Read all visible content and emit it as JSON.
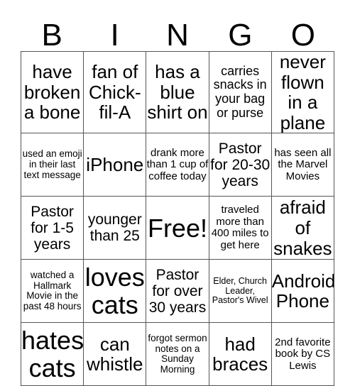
{
  "header": {
    "letters": [
      "B",
      "I",
      "N",
      "G",
      "O"
    ]
  },
  "cells": [
    [
      "have broken a bone",
      "fan of Chick-fil-A",
      "has a blue shirt on",
      "carries snacks in your bag or purse",
      "never flown in a plane"
    ],
    [
      "used an emoji in their last text message",
      "iPhone",
      "drank more than 1 cup of coffee today",
      "Pastor for 20-30 years",
      "has seen all the Marvel Movies"
    ],
    [
      "Pastor for 1-5 years",
      "younger than 25",
      "Free!",
      "traveled more than 400 miles to get here",
      "afraid of snakes"
    ],
    [
      "watched a Hallmark Movie in the past 48 hours",
      "loves cats",
      "Pastor for over 30 years",
      "Elder, Church Leader, Pastor's Wivel",
      "Android Phone"
    ],
    [
      "hates cats",
      "can whistle",
      "forgot sermon notes on a Sunday Morning",
      "had braces",
      "2nd favorite book by CS Lewis"
    ]
  ]
}
